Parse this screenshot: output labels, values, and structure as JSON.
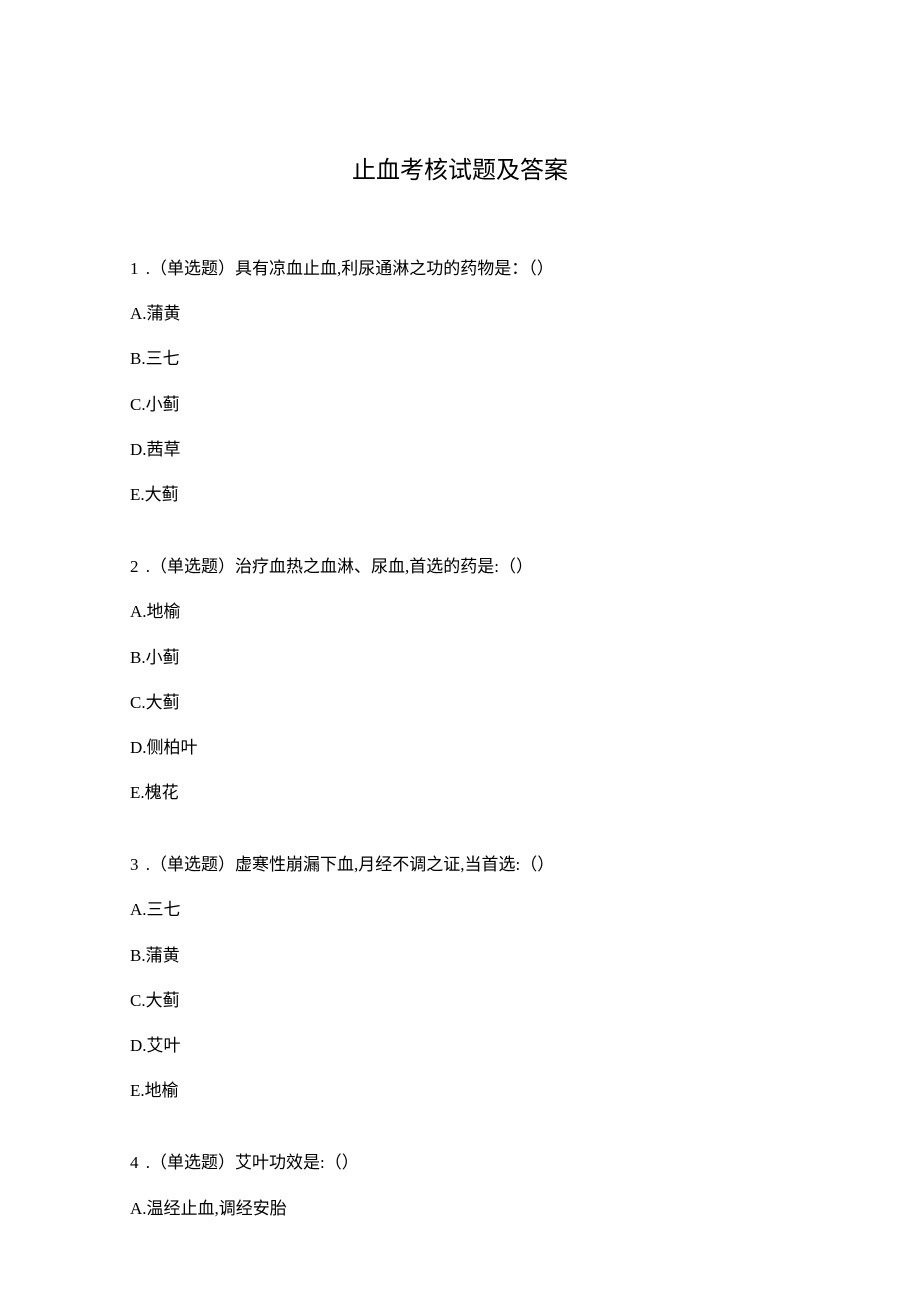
{
  "title": "止血考核试题及答案",
  "questions": [
    {
      "number": "1",
      "type": "（单选题）",
      "text": "具有凉血止血,利尿通淋之功的药物是：（）",
      "options": [
        "A.蒲黄",
        "B.三七",
        "C.小蓟",
        "D.茜草",
        "E.大蓟"
      ]
    },
    {
      "number": "2",
      "type": "（单选题）",
      "text": "治疗血热之血淋、尿血,首选的药是:（）",
      "options": [
        "A.地榆",
        "B.小蓟",
        "C.大蓟",
        "D.侧柏叶",
        "E.槐花"
      ]
    },
    {
      "number": "3",
      "type": "（单选题）",
      "text": "虚寒性崩漏下血,月经不调之证,当首选:（）",
      "options": [
        "A.三七",
        "B.蒲黄",
        "C.大蓟",
        "D.艾叶",
        "E.地榆"
      ]
    },
    {
      "number": "4",
      "type": "（单选题）",
      "text": "艾叶功效是:（）",
      "options": [
        "A.温经止血,调经安胎"
      ]
    }
  ]
}
